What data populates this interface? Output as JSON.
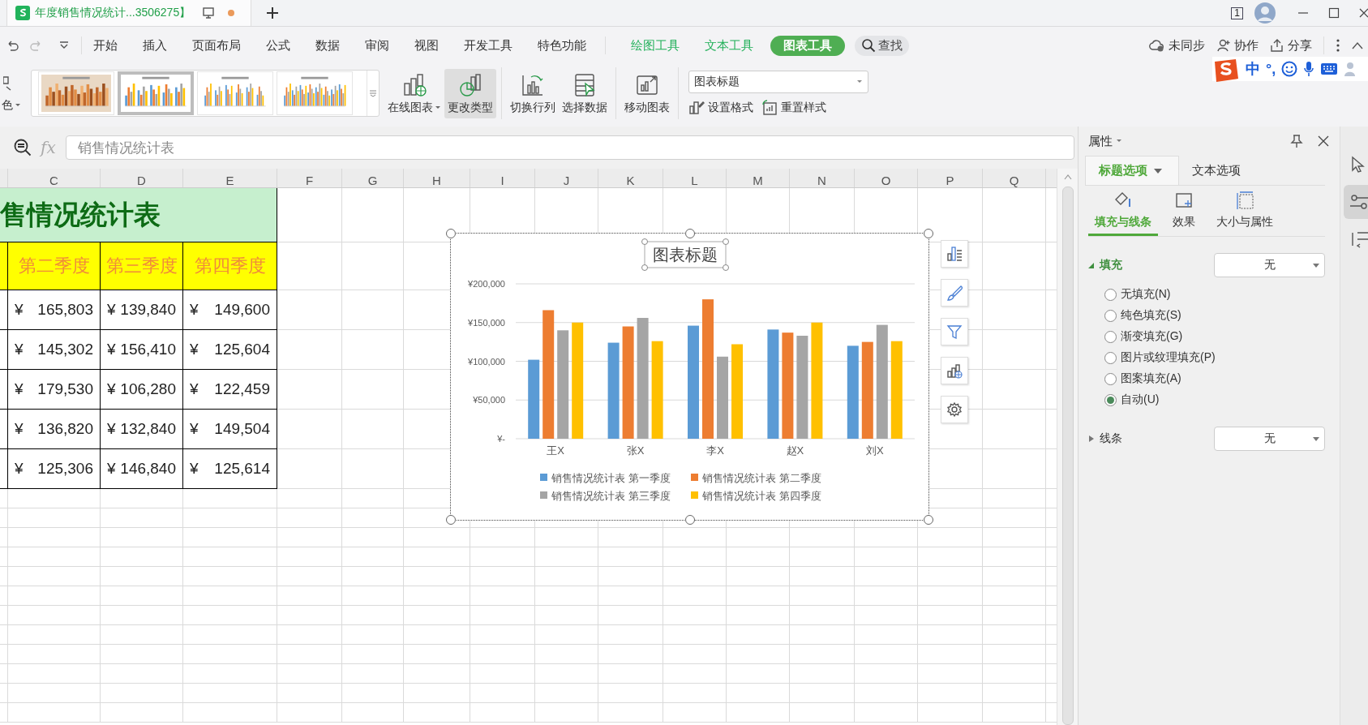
{
  "title_bar": {
    "document_title": "年度销售情况统计...3506275】",
    "window_count": "1"
  },
  "ime_bar": {
    "labels": [
      "中",
      "°,"
    ]
  },
  "menu": {
    "items": [
      {
        "label": "开始",
        "kind": "tab",
        "selected": false
      },
      {
        "label": "插入",
        "kind": "tab",
        "selected": false
      },
      {
        "label": "页面布局",
        "kind": "tab",
        "selected": false
      },
      {
        "label": "公式",
        "kind": "tab",
        "selected": false
      },
      {
        "label": "数据",
        "kind": "tab",
        "selected": false
      },
      {
        "label": "审阅",
        "kind": "tab",
        "selected": false
      },
      {
        "label": "视图",
        "kind": "tab",
        "selected": false
      },
      {
        "label": "开发工具",
        "kind": "tab",
        "selected": false
      },
      {
        "label": "特色功能",
        "kind": "tab",
        "selected": false
      },
      {
        "label": "绘图工具",
        "kind": "tool",
        "selected": false
      },
      {
        "label": "文本工具",
        "kind": "tool",
        "selected": false
      },
      {
        "label": "图表工具",
        "kind": "tool",
        "selected": true
      }
    ],
    "search_label": "查找",
    "actions": [
      "未同步",
      "协作",
      "分享"
    ]
  },
  "ribbon": {
    "color_label": "色",
    "chart_styles": [
      {
        "kind": "textured",
        "selected": false
      },
      {
        "kind": "classic",
        "selected": true
      },
      {
        "kind": "light",
        "selected": false
      },
      {
        "kind": "dense",
        "selected": false
      }
    ],
    "buttons": [
      {
        "label": "在线图表",
        "menu": true,
        "pressed": false
      },
      {
        "label": "更改类型",
        "menu": false,
        "pressed": true
      },
      {
        "label": "切换行列",
        "menu": false,
        "pressed": false
      },
      {
        "label": "选择数据",
        "menu": false,
        "pressed": false
      },
      {
        "label": "移动图表",
        "menu": false,
        "pressed": false
      }
    ],
    "element_select": "图表标题",
    "format_buttons": [
      "设置格式",
      "重置样式"
    ]
  },
  "formula_bar": {
    "fx": "fx",
    "value": "销售情况统计表"
  },
  "sheet": {
    "columns": [
      "C",
      "D",
      "E",
      "F",
      "G",
      "H",
      "I",
      "J",
      "K",
      "L",
      "M",
      "N",
      "O",
      "P",
      "Q"
    ],
    "title": "售情况统计表",
    "headers": [
      "第二季度",
      "第三季度",
      "第四季度"
    ],
    "rows": [
      [
        {
          "currency": "¥",
          "amount": "165,803"
        },
        {
          "currency": "¥",
          "amount": "139,840"
        },
        {
          "currency": "¥",
          "amount": "149,600"
        }
      ],
      [
        {
          "currency": "¥",
          "amount": "145,302"
        },
        {
          "currency": "¥",
          "amount": "156,410"
        },
        {
          "currency": "¥",
          "amount": "125,604"
        }
      ],
      [
        {
          "currency": "¥",
          "amount": "179,530"
        },
        {
          "currency": "¥",
          "amount": "106,280"
        },
        {
          "currency": "¥",
          "amount": "122,459"
        }
      ],
      [
        {
          "currency": "¥",
          "amount": "136,820"
        },
        {
          "currency": "¥",
          "amount": "132,840"
        },
        {
          "currency": "¥",
          "amount": "149,504"
        }
      ],
      [
        {
          "currency": "¥",
          "amount": "125,306"
        },
        {
          "currency": "¥",
          "amount": "146,840"
        },
        {
          "currency": "¥",
          "amount": "125,614"
        }
      ]
    ]
  },
  "chart": {
    "chart_data": {
      "type": "bar",
      "title": "图表标题",
      "grid": true,
      "legend": "bottom",
      "categories": [
        "王X",
        "张X",
        "李X",
        "赵X",
        "刘X"
      ],
      "series": [
        {
          "name": "销售情况统计表 第一季度",
          "color": "#5b9bd5",
          "values": [
            102000,
            124000,
            146000,
            141000,
            120000
          ]
        },
        {
          "name": "销售情况统计表 第二季度",
          "color": "#ed7d31",
          "values": [
            166000,
            145000,
            180000,
            137000,
            125000
          ]
        },
        {
          "name": "销售情况统计表 第三季度",
          "color": "#a5a5a5",
          "values": [
            140000,
            156000,
            106000,
            133000,
            147000
          ]
        },
        {
          "name": "销售情况统计表 第四季度",
          "color": "#ffc000",
          "values": [
            150000,
            126000,
            122000,
            150000,
            126000
          ]
        }
      ],
      "ylim": [
        0,
        200000
      ],
      "yticks": [
        {
          "value": 0,
          "label": "¥-"
        },
        {
          "value": 50000,
          "label": "¥50,000"
        },
        {
          "value": 100000,
          "label": "¥100,000"
        },
        {
          "value": 150000,
          "label": "¥150,000"
        },
        {
          "value": 200000,
          "label": "¥200,000"
        }
      ]
    }
  },
  "panel": {
    "title": "属性",
    "tabs": [
      {
        "label": "标题选项",
        "selected": true
      },
      {
        "label": "文本选项",
        "selected": false
      }
    ],
    "subtabs": [
      {
        "label": "填充与线条",
        "selected": true
      },
      {
        "label": "效果",
        "selected": false
      },
      {
        "label": "大小与属性",
        "selected": false
      }
    ],
    "sections": [
      {
        "label": "填充",
        "expanded": true,
        "value": "无",
        "options": [
          {
            "label": "无填充(N)",
            "selected": false
          },
          {
            "label": "纯色填充(S)",
            "selected": false
          },
          {
            "label": "渐变填充(G)",
            "selected": false
          },
          {
            "label": "图片或纹理填充(P)",
            "selected": false
          },
          {
            "label": "图案填充(A)",
            "selected": false
          },
          {
            "label": "自动(U)",
            "selected": true
          }
        ]
      },
      {
        "label": "线条",
        "expanded": false,
        "value": "无"
      }
    ]
  }
}
